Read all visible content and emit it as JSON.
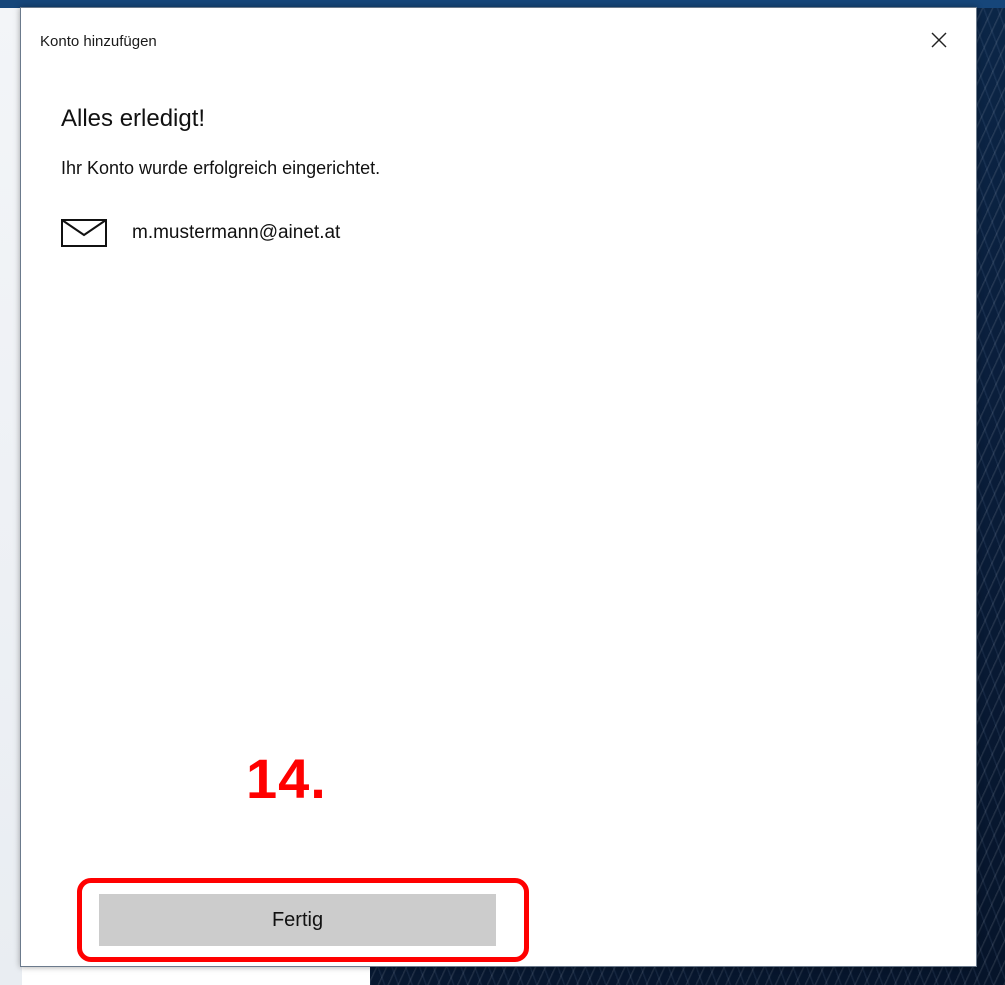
{
  "dialog": {
    "title": "Konto hinzufügen",
    "close_icon": "close-icon",
    "heading": "Alles erledigt!",
    "subtitle": "Ihr Konto wurde erfolgreich eingerichtet.",
    "account": {
      "icon": "mail-envelope-icon",
      "email": "m.mustermann@ainet.at"
    },
    "done_label": "Fertig"
  },
  "annotation": {
    "step_number": "14.",
    "color": "#ff0000"
  },
  "colors": {
    "button_bg": "#cccccc",
    "desktop_bg": "#0a1f3d"
  }
}
